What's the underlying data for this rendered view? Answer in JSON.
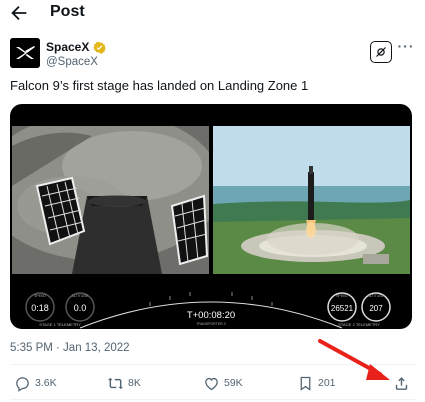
{
  "header": {
    "title": "Post"
  },
  "author": {
    "name": "SpaceX",
    "handle": "@SpaceX"
  },
  "tweet": {
    "text": "Falcon 9’s first stage has landed on Landing Zone 1"
  },
  "media": {
    "left_speed": "0:18",
    "left_alt": "0.0",
    "left_label": "STAGE 1 TELEMETRY",
    "left_speed_unit": "SPEED",
    "left_alt_unit": "ALTITUDE",
    "timer": "T+00:08:20",
    "timer_label": "TRANSPORTER-3",
    "right_speed": "26521",
    "right_alt": "207",
    "right_label": "STAGE 2 TELEMETRY",
    "right_speed_unit": "SPEED",
    "right_alt_unit": "ALTITUDE"
  },
  "meta": {
    "timestamp": "5:35 PM · Jan 13, 2022"
  },
  "actions": {
    "replies": "3.6K",
    "reposts": "8K",
    "likes": "59K",
    "bookmarks": "201"
  },
  "colors": {
    "arrow": "#e8221b",
    "muted": "#536471",
    "verified": "#e2b719"
  },
  "icons": {
    "back": "arrow-left-icon",
    "verified": "verified-badge-icon",
    "grok": "grok-icon",
    "more": "more-icon",
    "reply": "reply-icon",
    "repost": "repost-icon",
    "like": "heart-icon",
    "bookmark": "bookmark-icon",
    "share": "share-icon"
  }
}
